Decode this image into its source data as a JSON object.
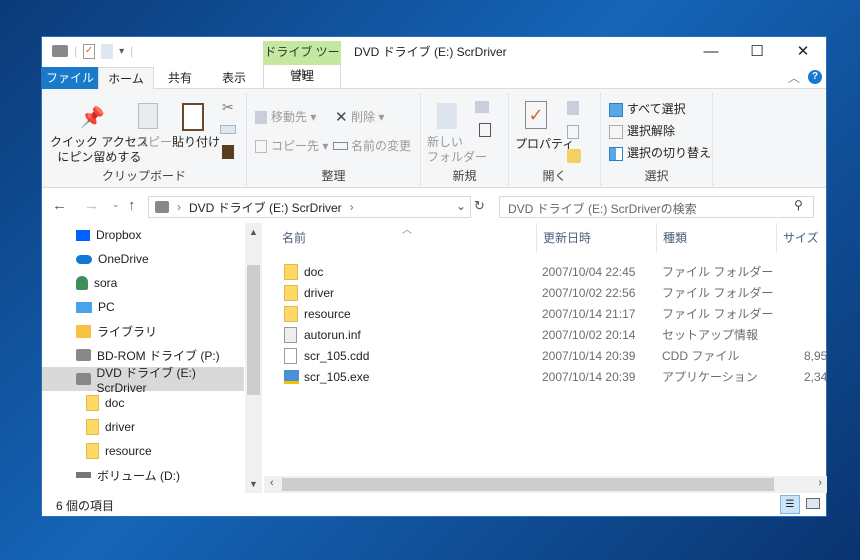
{
  "window": {
    "title": "DVD ドライブ (E:) ScrDriver",
    "context_tab": "ドライブ ツール",
    "min": "—",
    "max": "☐",
    "close": "✕"
  },
  "tabs": {
    "file": "ファイル",
    "home": "ホーム",
    "share": "共有",
    "view": "表示",
    "manage": "管理"
  },
  "ribbon": {
    "clipboard": {
      "label": "クリップボード",
      "pin": "クイック アクセス",
      "pin2": "にピン留めする",
      "copy": "コピー",
      "paste": "貼り付け"
    },
    "organize": {
      "label": "整理",
      "move": "移動先 ▾",
      "copyto": "コピー先 ▾",
      "delete": "削除 ▾",
      "rename": "名前の変更"
    },
    "new": {
      "label": "新規",
      "folder1": "新しい",
      "folder2": "フォルダー"
    },
    "open": {
      "label": "開く",
      "properties": "プロパティ"
    },
    "select": {
      "label": "選択",
      "all": "すべて選択",
      "none": "選択解除",
      "invert": "選択の切り替え"
    }
  },
  "address": {
    "path": "DVD ドライブ (E:) ScrDriver",
    "search_placeholder": "DVD ドライブ (E:) ScrDriverの検索"
  },
  "nav": [
    {
      "label": "Dropbox",
      "icon": "dropbox-icon"
    },
    {
      "label": "OneDrive",
      "icon": "onedrive-icon"
    },
    {
      "label": "sora",
      "icon": "user-icon"
    },
    {
      "label": "PC",
      "icon": "pc-icon"
    },
    {
      "label": "ライブラリ",
      "icon": "library-icon"
    },
    {
      "label": "BD-ROM ドライブ (P:)",
      "icon": "disc-drive-icon"
    },
    {
      "label": "DVD ドライブ (E:) ScrDriver",
      "icon": "disc-drive-icon",
      "selected": true
    },
    {
      "label": "doc",
      "icon": "folder-icon"
    },
    {
      "label": "driver",
      "icon": "folder-icon"
    },
    {
      "label": "resource",
      "icon": "folder-icon"
    },
    {
      "label": "ボリューム (D:)",
      "icon": "drive-icon"
    }
  ],
  "columns": [
    "名前",
    "更新日時",
    "種類",
    "サイズ"
  ],
  "files": [
    {
      "name": "doc",
      "date": "2007/10/04 22:45",
      "type": "ファイル フォルダー",
      "size": "",
      "icon": "folder"
    },
    {
      "name": "driver",
      "date": "2007/10/02 22:56",
      "type": "ファイル フォルダー",
      "size": "",
      "icon": "folder"
    },
    {
      "name": "resource",
      "date": "2007/10/14 21:17",
      "type": "ファイル フォルダー",
      "size": "",
      "icon": "folder"
    },
    {
      "name": "autorun.inf",
      "date": "2007/10/02 20:14",
      "type": "セットアップ情報",
      "size": "",
      "icon": "inf"
    },
    {
      "name": "scr_105.cdd",
      "date": "2007/10/14 20:39",
      "type": "CDD ファイル",
      "size": "8,95",
      "icon": "file"
    },
    {
      "name": "scr_105.exe",
      "date": "2007/10/14 20:39",
      "type": "アプリケーション",
      "size": "2,34",
      "icon": "exe"
    }
  ],
  "status": {
    "count": "6 個の項目"
  }
}
